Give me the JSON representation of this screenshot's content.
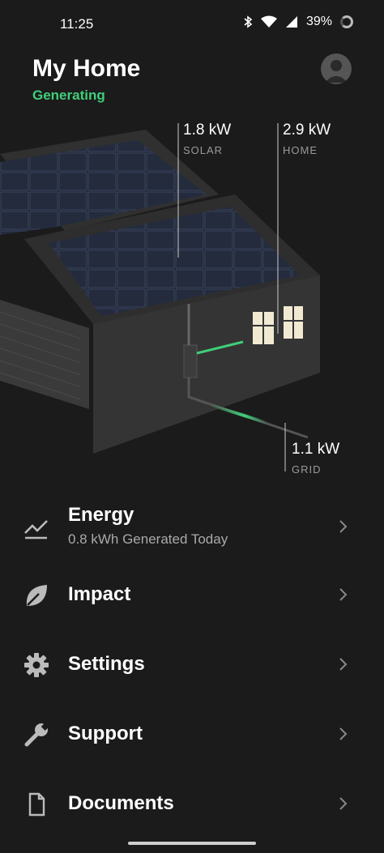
{
  "status": {
    "time": "11:25",
    "battery": "39%"
  },
  "header": {
    "title": "My Home",
    "state": "Generating",
    "avatar_icon": "person-icon"
  },
  "metrics": {
    "solar": {
      "value": "1.8 kW",
      "label": "SOLAR"
    },
    "home": {
      "value": "2.9 kW",
      "label": "HOME"
    },
    "grid": {
      "value": "1.1 kW",
      "label": "GRID"
    }
  },
  "menu": {
    "items": [
      {
        "label": "Energy",
        "sub": "0.8 kWh Generated Today",
        "icon": "chart-line-icon"
      },
      {
        "label": "Impact",
        "icon": "leaf-icon"
      },
      {
        "label": "Settings",
        "icon": "gear-icon"
      },
      {
        "label": "Support",
        "icon": "wrench-icon"
      },
      {
        "label": "Documents",
        "icon": "document-icon"
      }
    ]
  },
  "colors": {
    "accent_green": "#3fce7a",
    "background": "#1b1b1b"
  }
}
